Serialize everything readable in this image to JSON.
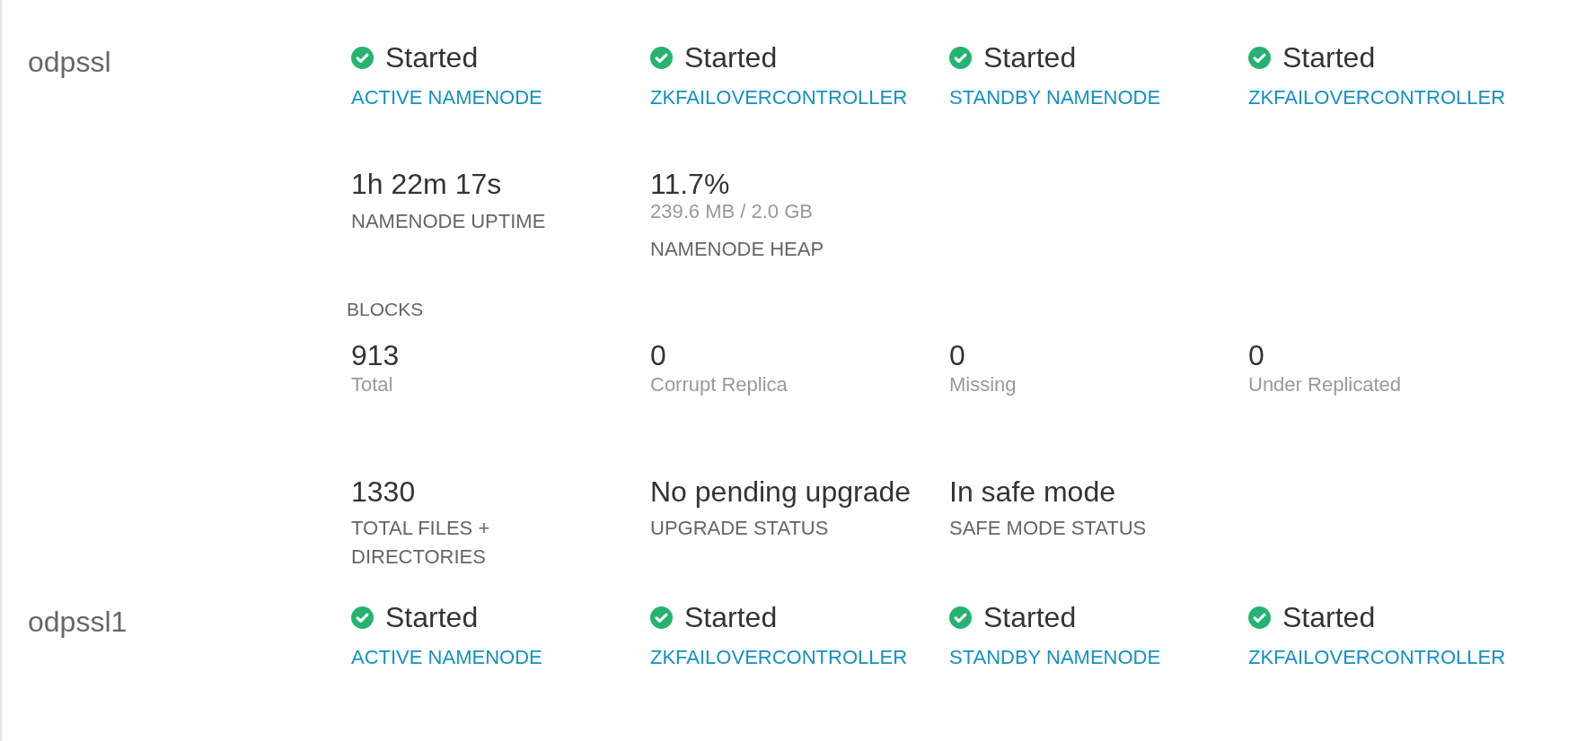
{
  "hosts": [
    {
      "name": "odpssl",
      "components": [
        {
          "status": "Started",
          "role": "ACTIVE NAMENODE"
        },
        {
          "status": "Started",
          "role": "ZKFAILOVERCONTROLLER"
        },
        {
          "status": "Started",
          "role": "STANDBY NAMENODE"
        },
        {
          "status": "Started",
          "role": "ZKFAILOVERCONTROLLER"
        }
      ],
      "metrics": [
        {
          "value": "1h 22m 17s",
          "label": "NAMENODE UPTIME"
        },
        {
          "value": "11.7%",
          "detail": "239.6 MB / 2.0 GB",
          "label": "NAMENODE HEAP"
        }
      ],
      "blocks": {
        "title": "BLOCKS",
        "items": [
          {
            "value": "913",
            "label": "Total"
          },
          {
            "value": "0",
            "label": "Corrupt Replica"
          },
          {
            "value": "0",
            "label": "Missing"
          },
          {
            "value": "0",
            "label": "Under Replicated"
          }
        ]
      },
      "summary": [
        {
          "value": "1330",
          "label": "TOTAL FILES + DIRECTORIES"
        },
        {
          "value": "No pending upgrade",
          "label": "UPGRADE STATUS"
        },
        {
          "value": "In safe mode",
          "label": "SAFE MODE STATUS"
        }
      ]
    },
    {
      "name": "odpssl1",
      "components": [
        {
          "status": "Started",
          "role": "ACTIVE NAMENODE"
        },
        {
          "status": "Started",
          "role": "ZKFAILOVERCONTROLLER"
        },
        {
          "status": "Started",
          "role": "STANDBY NAMENODE"
        },
        {
          "status": "Started",
          "role": "ZKFAILOVERCONTROLLER"
        }
      ]
    }
  ]
}
